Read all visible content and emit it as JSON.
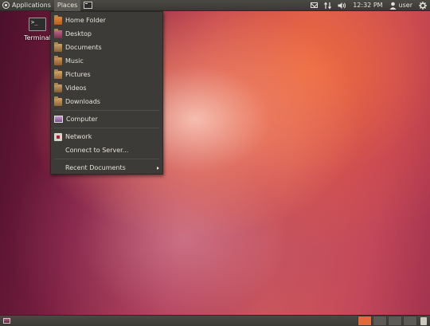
{
  "top_panel": {
    "applications_label": "Applications",
    "places_label": "Places",
    "clock": "12:32 PM",
    "user": "user",
    "icons": [
      "ubuntu-logo-icon",
      "terminal-launcher-icon",
      "mail-icon",
      "network-arrows-icon",
      "volume-icon",
      "user-icon",
      "gear-icon"
    ]
  },
  "desktop": {
    "icons": [
      {
        "label": "Terminal",
        "glyph": ">_"
      }
    ]
  },
  "places_menu": {
    "items": [
      {
        "label": "Home Folder",
        "icon": "home-folder-icon"
      },
      {
        "label": "Desktop",
        "icon": "desktop-folder-icon"
      },
      {
        "label": "Documents",
        "icon": "documents-folder-icon"
      },
      {
        "label": "Music",
        "icon": "music-folder-icon"
      },
      {
        "label": "Pictures",
        "icon": "pictures-folder-icon"
      },
      {
        "label": "Videos",
        "icon": "videos-folder-icon"
      },
      {
        "label": "Downloads",
        "icon": "downloads-folder-icon"
      },
      {
        "label": "Computer",
        "icon": "computer-icon"
      },
      {
        "label": "Network",
        "icon": "network-icon"
      },
      {
        "label": "Connect to Server...",
        "icon": ""
      },
      {
        "label": "Recent Documents",
        "icon": "",
        "submenu": true
      }
    ]
  },
  "bottom_panel": {
    "workspace_count": 4,
    "active_workspace": 1
  },
  "colors": {
    "panel": "#3c3b37",
    "panel_text": "#dfdbd2",
    "accent": "#e26a3a"
  }
}
